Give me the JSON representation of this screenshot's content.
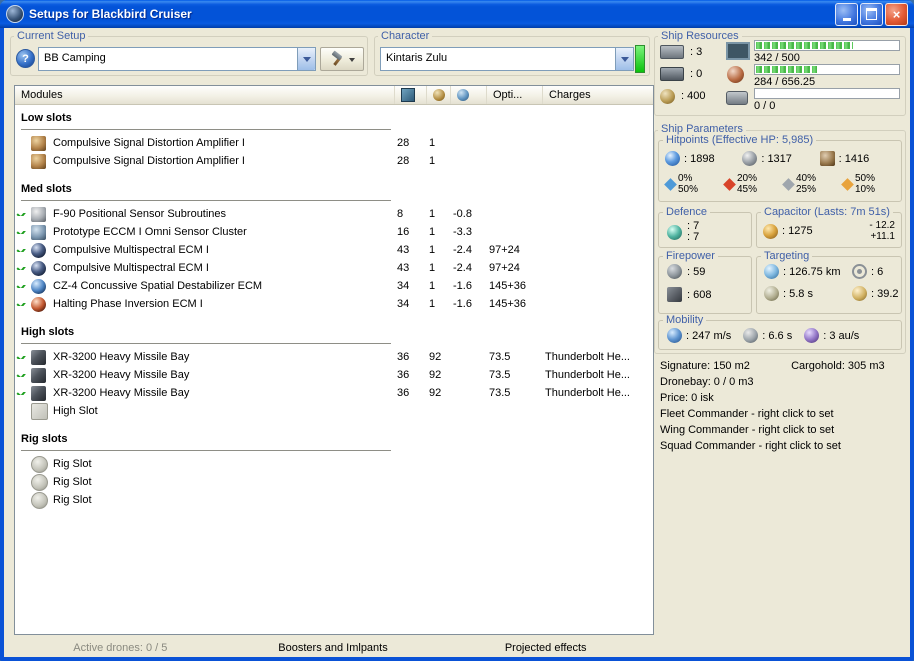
{
  "window": {
    "title": "Setups for Blackbird Cruiser"
  },
  "colors": {
    "titlebar_blue": "#0353D8",
    "label_blue": "#4060A8",
    "module_active_green": "#1FA01F",
    "character_status_green": "#0CC20C",
    "bar_fill_green": "#52C452"
  },
  "toolbar": {
    "current_setup": {
      "label": "Current Setup",
      "value": "BB Camping"
    },
    "character": {
      "label": "Character",
      "value": "Kintaris Zulu"
    }
  },
  "modules_table": {
    "columns": {
      "modules": "Modules",
      "opti": "Opti...",
      "charges": "Charges"
    },
    "sections": [
      {
        "title": "Low slots",
        "rows": [
          {
            "checked": false,
            "icon": "signal-amplifier",
            "name": "Compulsive Signal Distortion Amplifier I",
            "cpu": "28",
            "pg": "1",
            "cap": "",
            "opti": "",
            "charge": ""
          },
          {
            "checked": false,
            "icon": "signal-amplifier",
            "name": "Compulsive Signal Distortion Amplifier I",
            "cpu": "28",
            "pg": "1",
            "cap": "",
            "opti": "",
            "charge": ""
          }
        ]
      },
      {
        "title": "Med slots",
        "rows": [
          {
            "checked": true,
            "icon": "sensor-booster",
            "name": "F-90 Positional Sensor Subroutines",
            "cpu": "8",
            "pg": "1",
            "cap": "-0.8",
            "opti": "",
            "charge": ""
          },
          {
            "checked": true,
            "icon": "eccm",
            "name": "Prototype ECCM I Omni Sensor Cluster",
            "cpu": "16",
            "pg": "1",
            "cap": "-3.3",
            "opti": "",
            "charge": ""
          },
          {
            "checked": true,
            "icon": "ecm-multispectral",
            "name": "Compulsive Multispectral ECM I",
            "cpu": "43",
            "pg": "1",
            "cap": "-2.4",
            "opti": "97+24",
            "charge": ""
          },
          {
            "checked": true,
            "icon": "ecm-multispectral",
            "name": "Compulsive Multispectral ECM I",
            "cpu": "43",
            "pg": "1",
            "cap": "-2.4",
            "opti": "97+24",
            "charge": ""
          },
          {
            "checked": true,
            "icon": "ecm-ladar",
            "name": "CZ-4 Concussive Spatial Destabilizer ECM",
            "cpu": "34",
            "pg": "1",
            "cap": "-1.6",
            "opti": "145+36",
            "charge": ""
          },
          {
            "checked": true,
            "icon": "ecm-magnetometric",
            "name": "Halting Phase Inversion ECM I",
            "cpu": "34",
            "pg": "1",
            "cap": "-1.6",
            "opti": "145+36",
            "charge": ""
          }
        ]
      },
      {
        "title": "High slots",
        "rows": [
          {
            "checked": true,
            "icon": "missile-launcher",
            "name": "XR-3200 Heavy Missile Bay",
            "cpu": "36",
            "pg": "92",
            "cap": "",
            "opti": "73.5",
            "charge": "Thunderbolt He..."
          },
          {
            "checked": true,
            "icon": "missile-launcher",
            "name": "XR-3200 Heavy Missile Bay",
            "cpu": "36",
            "pg": "92",
            "cap": "",
            "opti": "73.5",
            "charge": "Thunderbolt He..."
          },
          {
            "checked": true,
            "icon": "missile-launcher",
            "name": "XR-3200 Heavy Missile Bay",
            "cpu": "36",
            "pg": "92",
            "cap": "",
            "opti": "73.5",
            "charge": "Thunderbolt He..."
          },
          {
            "checked": false,
            "icon": "empty-high-slot",
            "name": "High Slot",
            "cpu": "",
            "pg": "",
            "cap": "",
            "opti": "",
            "charge": ""
          }
        ]
      },
      {
        "title": "Rig slots",
        "rows": [
          {
            "checked": false,
            "icon": "empty-rig-slot",
            "name": "Rig Slot",
            "cpu": "",
            "pg": "",
            "cap": "",
            "opti": "",
            "charge": ""
          },
          {
            "checked": false,
            "icon": "empty-rig-slot",
            "name": "Rig Slot",
            "cpu": "",
            "pg": "",
            "cap": "",
            "opti": "",
            "charge": ""
          },
          {
            "checked": false,
            "icon": "empty-rig-slot",
            "name": "Rig Slot",
            "cpu": "",
            "pg": "",
            "cap": "",
            "opti": "",
            "charge": ""
          }
        ]
      }
    ]
  },
  "ship_resources": {
    "label": "Ship Resources",
    "hardpoints": [
      {
        "icon": "turret-hardpoints-icon",
        "value": ": 3"
      },
      {
        "icon": "launcher-hardpoints-icon",
        "value": ": 0"
      },
      {
        "icon": "calibration-icon",
        "value": ": 400"
      }
    ],
    "bars": [
      {
        "icon": "cpu-icon",
        "text": "342 / 500",
        "fill": 0.684
      },
      {
        "icon": "powergrid-icon",
        "text": "284 / 656.25",
        "fill": 0.433
      },
      {
        "icon": "drone-bay-icon",
        "text": "0 / 0",
        "fill": 0
      }
    ]
  },
  "ship_parameters": {
    "label": "Ship Parameters",
    "hitpoints": {
      "label": "Hitpoints (Effective HP: 5,985)",
      "shield": ": 1898",
      "armor": ": 1317",
      "structure": ": 1416",
      "resists": [
        {
          "type": "em",
          "shield": "0%",
          "armor": "50%"
        },
        {
          "type": "thermal",
          "shield": "20%",
          "armor": "45%"
        },
        {
          "type": "kinetic",
          "shield": "40%",
          "armor": "25%"
        },
        {
          "type": "explosive",
          "shield": "50%",
          "armor": "10%"
        }
      ]
    },
    "defence": {
      "label": "Defence",
      "top": ": 7",
      "bottom": ": 7"
    },
    "capacitor": {
      "label": "Capacitor (Lasts: 7m 51s)",
      "amount": ": 1275",
      "drain": "- 12.2",
      "recharge": "+11.1"
    },
    "firepower": {
      "label": "Firepower",
      "turret": ": 59",
      "missile": ": 608"
    },
    "targeting": {
      "label": "Targeting",
      "range": ": 126.75 km",
      "max_targets": ": 6",
      "scan_resolution": ": 5.8 s",
      "sensor_strength": ": 39.2"
    },
    "mobility": {
      "label": "Mobility",
      "speed": ": 247 m/s",
      "agility": ": 6.6 s",
      "warp": ": 3 au/s"
    }
  },
  "ship_stats": {
    "signature": "Signature: 150 m2",
    "cargohold": "Cargohold: 305 m3",
    "dronebay": "Dronebay: 0 / 0 m3",
    "price": "Price: 0 isk",
    "fleet_commander": "Fleet Commander - right click to set",
    "wing_commander": "Wing Commander - right click to set",
    "squad_commander": "Squad Commander - right click to set"
  },
  "bottom_tabs": {
    "active_drones": "Active drones: 0 / 5",
    "boosters": "Boosters and Imlpants",
    "projected": "Projected effects"
  }
}
